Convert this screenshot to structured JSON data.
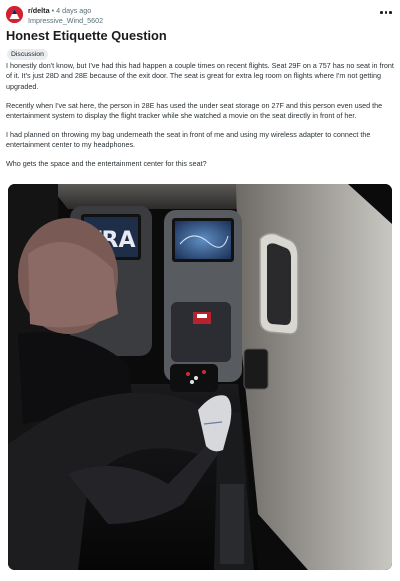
{
  "post": {
    "subreddit": "r/delta",
    "separator": "•",
    "time_ago": "4 days ago",
    "author": "Impressive_Wind_5602",
    "title": "Honest Etiquette Question",
    "flair": "Discussion",
    "paragraphs": [
      "I honestly don't know, but I've had this had happen a couple times on recent flights. Seat 29F on a 757 has no seat in front of it. It's just 28D and 28E because of the exit door. The seat is great for extra leg room on flights where I'm not getting upgraded.",
      "Recently when I've sat here, the person in 28E has used the under seat storage on 27F and this person even used the entertainment system to display the flight tracker while she watched a movie on the seat directly in front of her.",
      "I had planned on throwing my bag underneath the seat in front of me and using my wireless adapter to connect the entertainment center to my headphones.",
      "Who gets the space and the entertainment center for this seat?"
    ]
  },
  "photo": {
    "screen_text": "TRA"
  },
  "icons": {
    "avatar": "subreddit-avatar-icon",
    "more": "more-options-icon"
  },
  "colors": {
    "avatar_bg": "#e32636",
    "meta_text": "#576f76",
    "flair_bg": "#eaedef"
  }
}
